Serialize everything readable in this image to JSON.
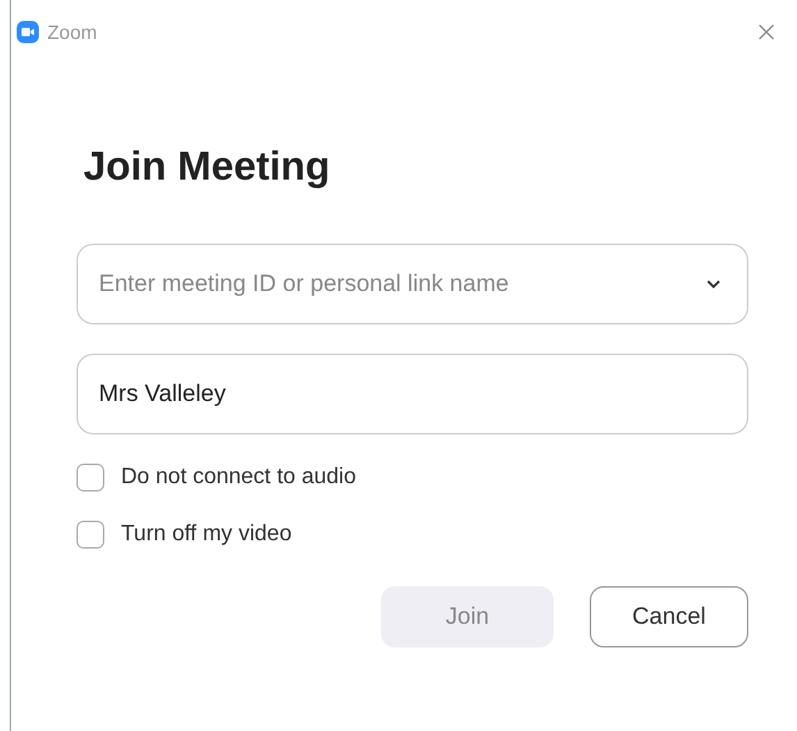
{
  "window": {
    "title": "Zoom"
  },
  "heading": "Join Meeting",
  "meeting_field": {
    "placeholder": "Enter meeting ID or personal link name"
  },
  "name_field": {
    "value": "Mrs Valleley"
  },
  "options": [
    {
      "label": "Do not connect to audio",
      "checked": false
    },
    {
      "label": "Turn off my video",
      "checked": false
    }
  ],
  "buttons": [
    {
      "label": "Join",
      "kind": "primary",
      "disabled": true
    },
    {
      "label": "Cancel",
      "kind": "secondary",
      "disabled": false
    }
  ]
}
